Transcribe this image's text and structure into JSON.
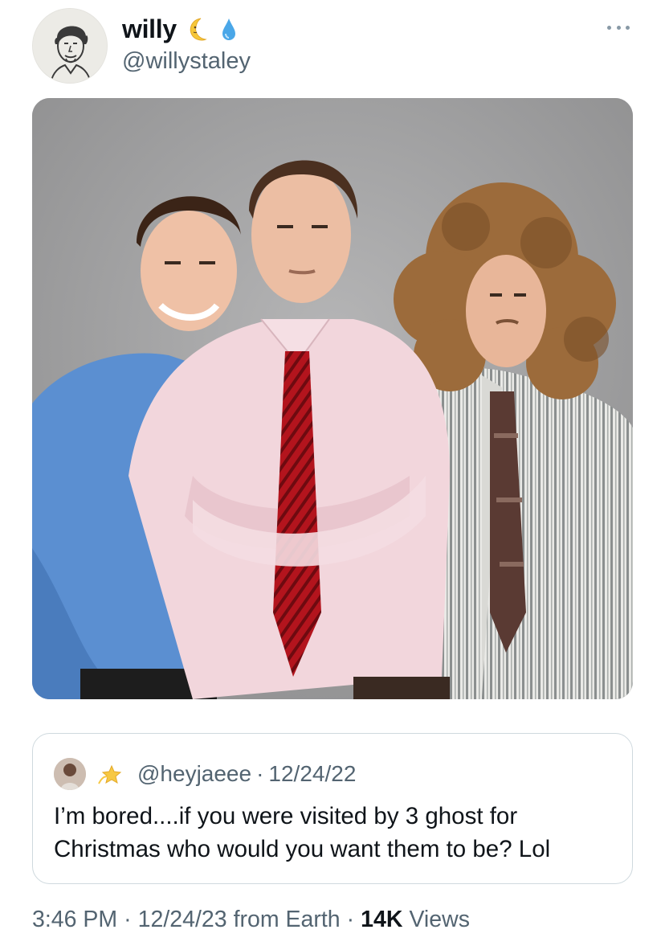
{
  "tweet": {
    "author": {
      "display_name": "willy",
      "name_emojis": [
        "crescent-moon-face-icon",
        "droplet-icon"
      ],
      "handle": "@willystaley"
    },
    "more_icon": "more-horizontal-icon",
    "media": {
      "type": "photo",
      "background_color": "#a7a7a8"
    },
    "quoted_tweet": {
      "avatar_icon": "avatar",
      "author_emoji": "dizzy-icon",
      "handle": "@heyjaeee",
      "separator": "·",
      "date": "12/24/22",
      "text": "I’m bored....if you were visited by 3 ghost for Christmas who would you want them to be? Lol"
    },
    "meta": {
      "time": "3:46 PM",
      "separator": "·",
      "date": "12/24/23",
      "source": "from Earth",
      "views_count": "14K",
      "views_label": "Views"
    }
  },
  "colors": {
    "text_primary": "#0f1419",
    "text_secondary": "#536471",
    "border": "#cfd9de"
  }
}
